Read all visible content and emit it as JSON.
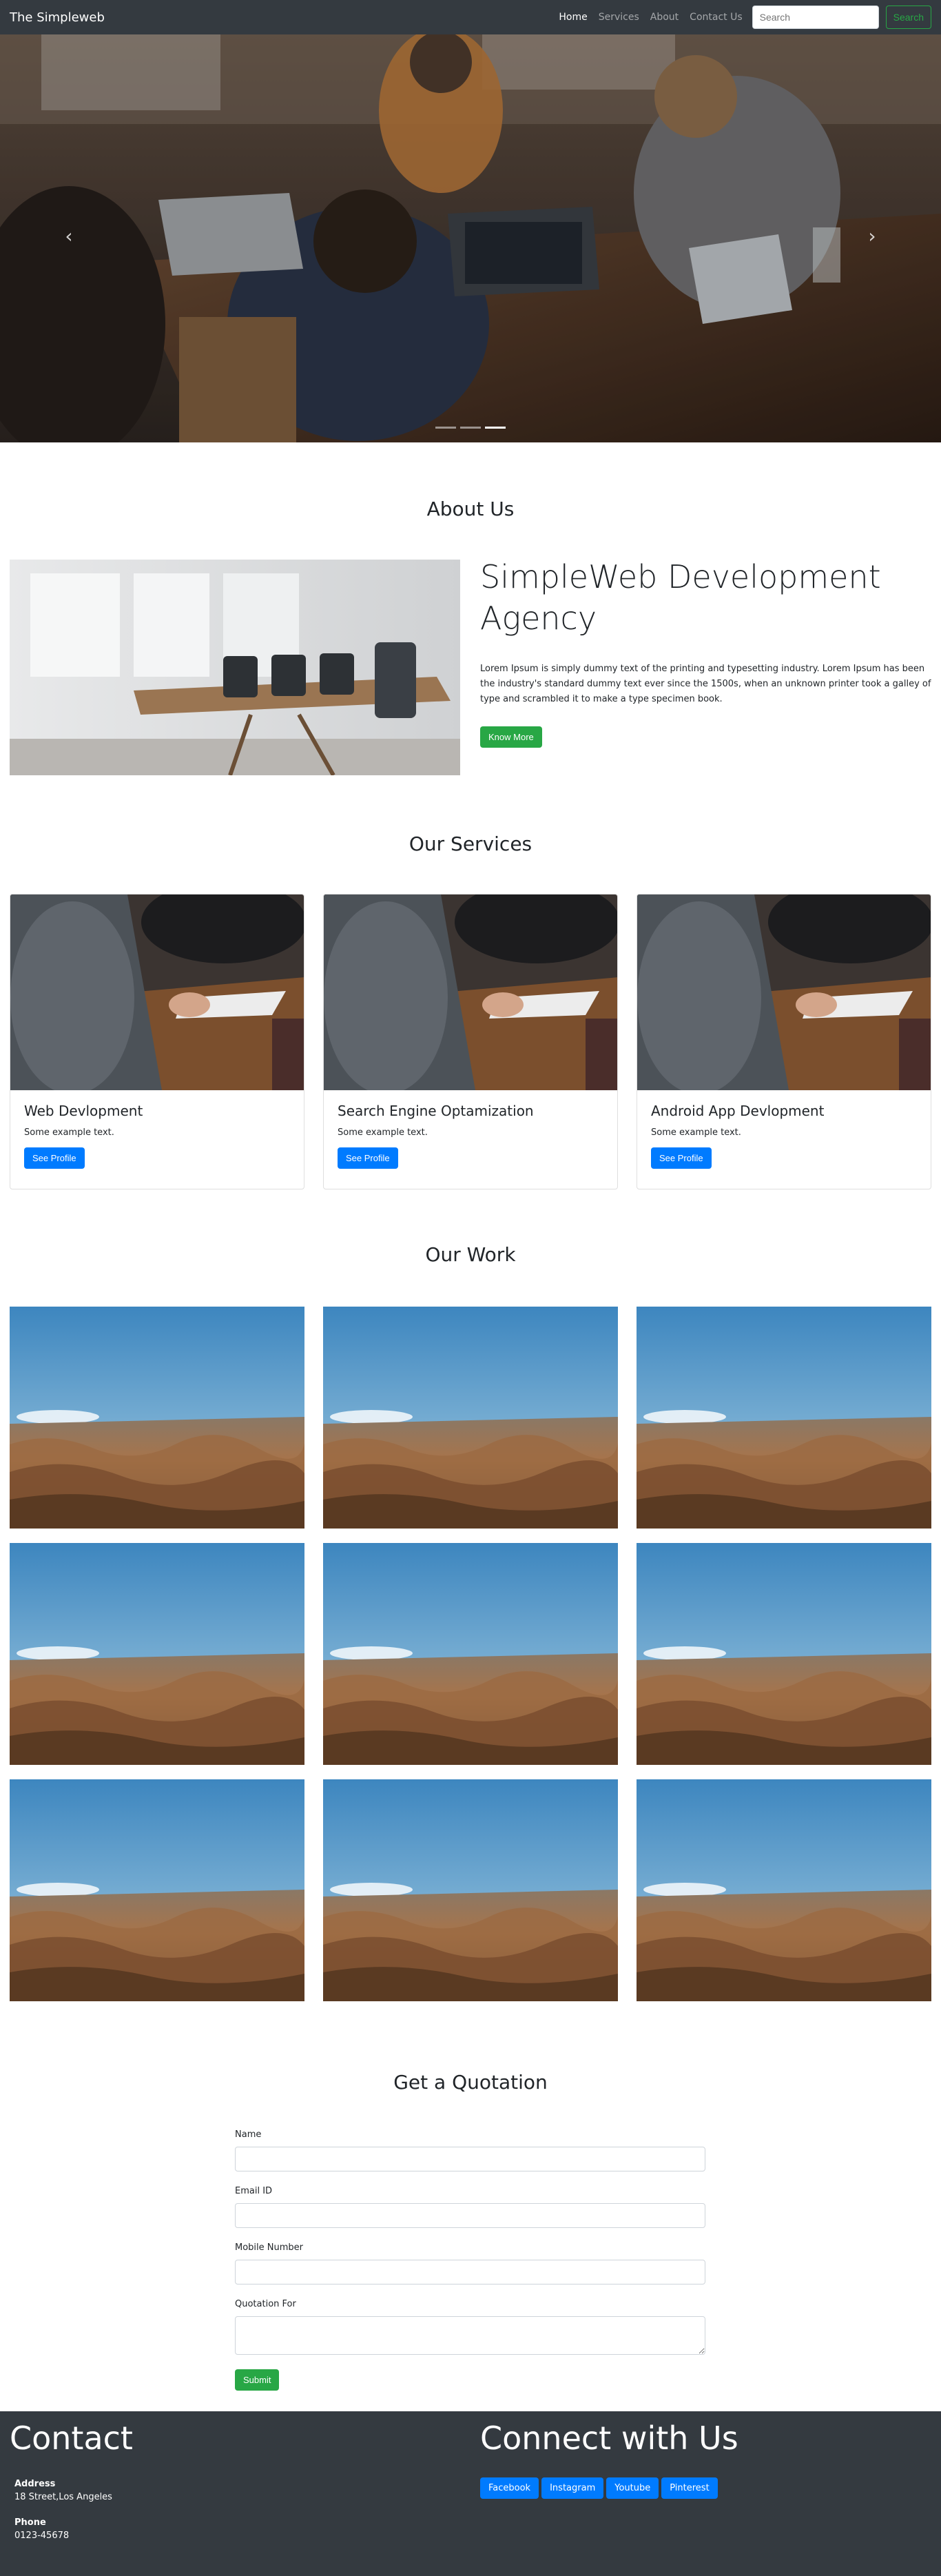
{
  "navbar": {
    "brand": "The Simpleweb",
    "links": [
      {
        "label": "Home",
        "active": true
      },
      {
        "label": "Services",
        "active": false
      },
      {
        "label": "About",
        "active": false
      },
      {
        "label": "Contact Us",
        "active": false
      }
    ],
    "search_placeholder": "Search",
    "search_button": "Search"
  },
  "hero": {
    "prev_icon": "chevron-left-icon",
    "next_icon": "chevron-right-icon",
    "indicators": 3,
    "active_indicator": 3
  },
  "about": {
    "title": "About Us",
    "heading": "SimpleWeb Development Agency",
    "body": "Lorem Ipsum is simply dummy text of the printing and typesetting industry. Lorem Ipsum has been the industry's standard dummy text ever since the 1500s, when an unknown printer took a galley of type and scrambled it to make a type specimen book.",
    "button": "Know More"
  },
  "services": {
    "title": "Our Services",
    "cards": [
      {
        "title": "Web Devlopment",
        "text": "Some example text.",
        "button": "See Profile"
      },
      {
        "title": "Search Engine Optamization",
        "text": "Some example text.",
        "button": "See Profile"
      },
      {
        "title": "Android App Devlopment",
        "text": "Some example text.",
        "button": "See Profile"
      }
    ]
  },
  "work": {
    "title": "Our Work"
  },
  "quotation": {
    "title": "Get a Quotation",
    "fields": [
      "Name",
      "Email ID",
      "Mobile Number",
      "Quotation For"
    ],
    "submit": "Submit"
  },
  "footer": {
    "contact_title": "Contact",
    "address_label": "Address",
    "address_value": "18 Street,Los Angeles",
    "phone_label": "Phone",
    "phone_value": "0123-45678",
    "connect_title": "Connect with Us",
    "social": [
      "Facebook",
      "Instagram",
      "Youtube",
      "Pinterest"
    ]
  },
  "colors": {
    "navbar": "#343a40",
    "primary": "#007bff",
    "success": "#28a745"
  }
}
